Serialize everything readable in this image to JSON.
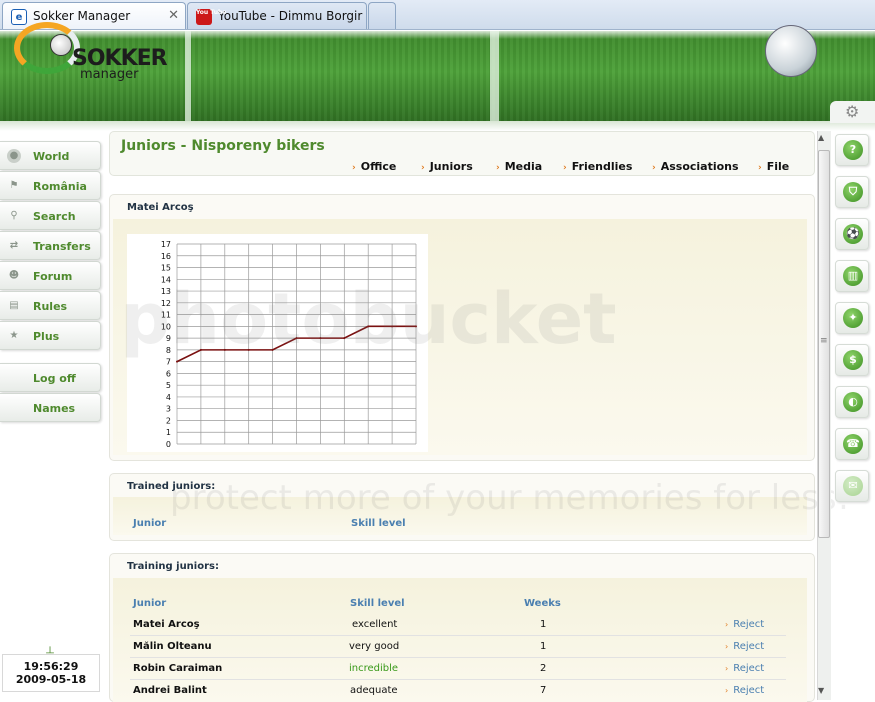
{
  "browser": {
    "tabs": [
      {
        "label": "Sokker Manager",
        "favicon": "ie-icon"
      },
      {
        "label": "YouTube - Dimmu Borgir ...",
        "favicon": "youtube-icon"
      }
    ],
    "close_glyph": "✕",
    "youtube_favicon_text": "You Tube"
  },
  "banner": {
    "logo_line1": "SOKKER",
    "logo_line2": "manager",
    "icon": "settings-gears-icon"
  },
  "sidebar": {
    "items": [
      {
        "label": "World",
        "icon": "globe-icon"
      },
      {
        "label": "România",
        "icon": "flag-icon"
      },
      {
        "label": "Search",
        "icon": "search-icon"
      },
      {
        "label": "Transfers",
        "icon": "transfers-icon"
      },
      {
        "label": "Forum",
        "icon": "forum-icon"
      },
      {
        "label": "Rules",
        "icon": "rules-icon"
      },
      {
        "label": "Plus",
        "icon": "star-icon"
      }
    ],
    "account": [
      {
        "label": "Log off"
      },
      {
        "label": "Names"
      }
    ],
    "clock": {
      "time": "19:56:29",
      "date": "2009-05-18"
    }
  },
  "header": {
    "title": "Juniors - Nisporeny bikers",
    "nav": [
      "Office",
      "Juniors",
      "Media",
      "Friendlies",
      "Associations",
      "File"
    ]
  },
  "player_chart": {
    "title": "Matei Arcoş"
  },
  "chart_data": {
    "type": "line",
    "title": "",
    "xlabel": "",
    "ylabel": "",
    "y_ticks": [
      0,
      1,
      2,
      3,
      4,
      5,
      6,
      7,
      8,
      9,
      10,
      11,
      12,
      13,
      14,
      15,
      16,
      17
    ],
    "ylim": [
      0,
      17
    ],
    "grid": true,
    "series": [
      {
        "values": [
          7,
          8,
          8,
          8,
          8,
          9,
          9,
          9,
          10,
          10,
          10
        ],
        "color": "#7a1010"
      }
    ]
  },
  "trained": {
    "title": "Trained juniors:",
    "columns": [
      "Junior",
      "Skill level"
    ]
  },
  "training": {
    "title": "Training juniors:",
    "columns": [
      "Junior",
      "Skill level",
      "Weeks"
    ],
    "reject_label": "Reject",
    "rows": [
      {
        "name": "Matei Arcoş",
        "skill": "excellent",
        "weeks": "1",
        "skill_color": "#111111"
      },
      {
        "name": "Mălin Olteanu",
        "skill": "very good",
        "weeks": "1",
        "skill_color": "#111111"
      },
      {
        "name": "Robin Caraiman",
        "skill": "incredible",
        "weeks": "2",
        "skill_color": "#3a9a1a"
      },
      {
        "name": "Andrei Balint",
        "skill": "adequate",
        "weeks": "7",
        "skill_color": "#111111"
      }
    ]
  },
  "right_icons": [
    {
      "icon": "help-icon",
      "glyph": "?"
    },
    {
      "icon": "shield-icon",
      "glyph": "⛉"
    },
    {
      "icon": "player-icon",
      "glyph": "⚽"
    },
    {
      "icon": "tactics-icon",
      "glyph": "▥"
    },
    {
      "icon": "training-icon",
      "glyph": "✦"
    },
    {
      "icon": "money-icon",
      "glyph": "$"
    },
    {
      "icon": "stadium-icon",
      "glyph": "◐"
    },
    {
      "icon": "phone-icon",
      "glyph": "☎"
    },
    {
      "icon": "mail-icon",
      "glyph": "✉"
    }
  ],
  "watermark": {
    "logo_text": "photobucket",
    "tagline": "protect more of your memories for less!"
  }
}
